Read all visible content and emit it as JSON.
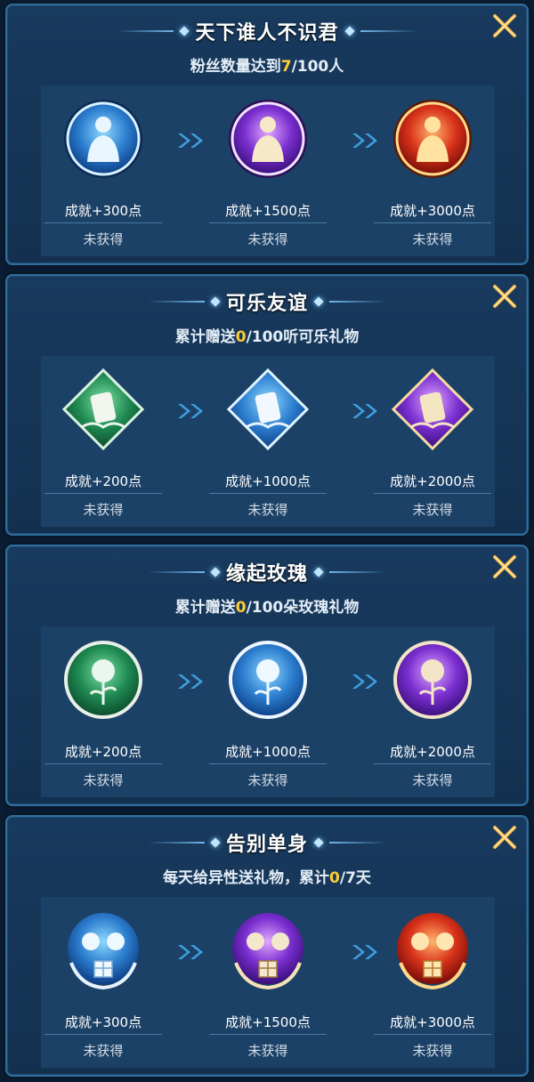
{
  "colors": {
    "highlight": "#ffcc33",
    "card_bg": "#183a5e",
    "panel_bg": "#1c4166",
    "close_icon": "#f6b845"
  },
  "close_icon_name": "close-x-icon",
  "arrow_icon_name": "double-chevron-right-icon",
  "achievements": [
    {
      "title": "天下谁人不识君",
      "subtitle_prefix": "粉丝数量达到",
      "progress_current": "7",
      "subtitle_suffix": "/100人",
      "tiers": [
        {
          "medal": "fan-medal-blue-icon",
          "points": "成就+300点",
          "status": "未获得"
        },
        {
          "medal": "fan-medal-purple-icon",
          "points": "成就+1500点",
          "status": "未获得"
        },
        {
          "medal": "fan-medal-gold-icon",
          "points": "成就+3000点",
          "status": "未获得"
        }
      ]
    },
    {
      "title": "可乐友谊",
      "subtitle_prefix": "累计赠送",
      "progress_current": "0",
      "subtitle_suffix": "/100听可乐礼物",
      "tiers": [
        {
          "medal": "cola-medal-green-icon",
          "points": "成就+200点",
          "status": "未获得"
        },
        {
          "medal": "cola-medal-blue-icon",
          "points": "成就+1000点",
          "status": "未获得"
        },
        {
          "medal": "cola-medal-purple-icon",
          "points": "成就+2000点",
          "status": "未获得"
        }
      ]
    },
    {
      "title": "缘起玫瑰",
      "subtitle_prefix": "累计赠送",
      "progress_current": "0",
      "subtitle_suffix": "/100朵玫瑰礼物",
      "tiers": [
        {
          "medal": "rose-medal-green-icon",
          "points": "成就+200点",
          "status": "未获得"
        },
        {
          "medal": "rose-medal-blue-icon",
          "points": "成就+1000点",
          "status": "未获得"
        },
        {
          "medal": "rose-medal-purple-icon",
          "points": "成就+2000点",
          "status": "未获得"
        }
      ]
    },
    {
      "title": "告别单身",
      "subtitle_prefix": "每天给异性送礼物，累计",
      "progress_current": "0",
      "subtitle_suffix": "/7天",
      "tiers": [
        {
          "medal": "couple-medal-blue-icon",
          "points": "成就+300点",
          "status": "未获得"
        },
        {
          "medal": "couple-medal-purple-icon",
          "points": "成就+1500点",
          "status": "未获得"
        },
        {
          "medal": "couple-medal-gold-icon",
          "points": "成就+3000点",
          "status": "未获得"
        }
      ]
    }
  ]
}
